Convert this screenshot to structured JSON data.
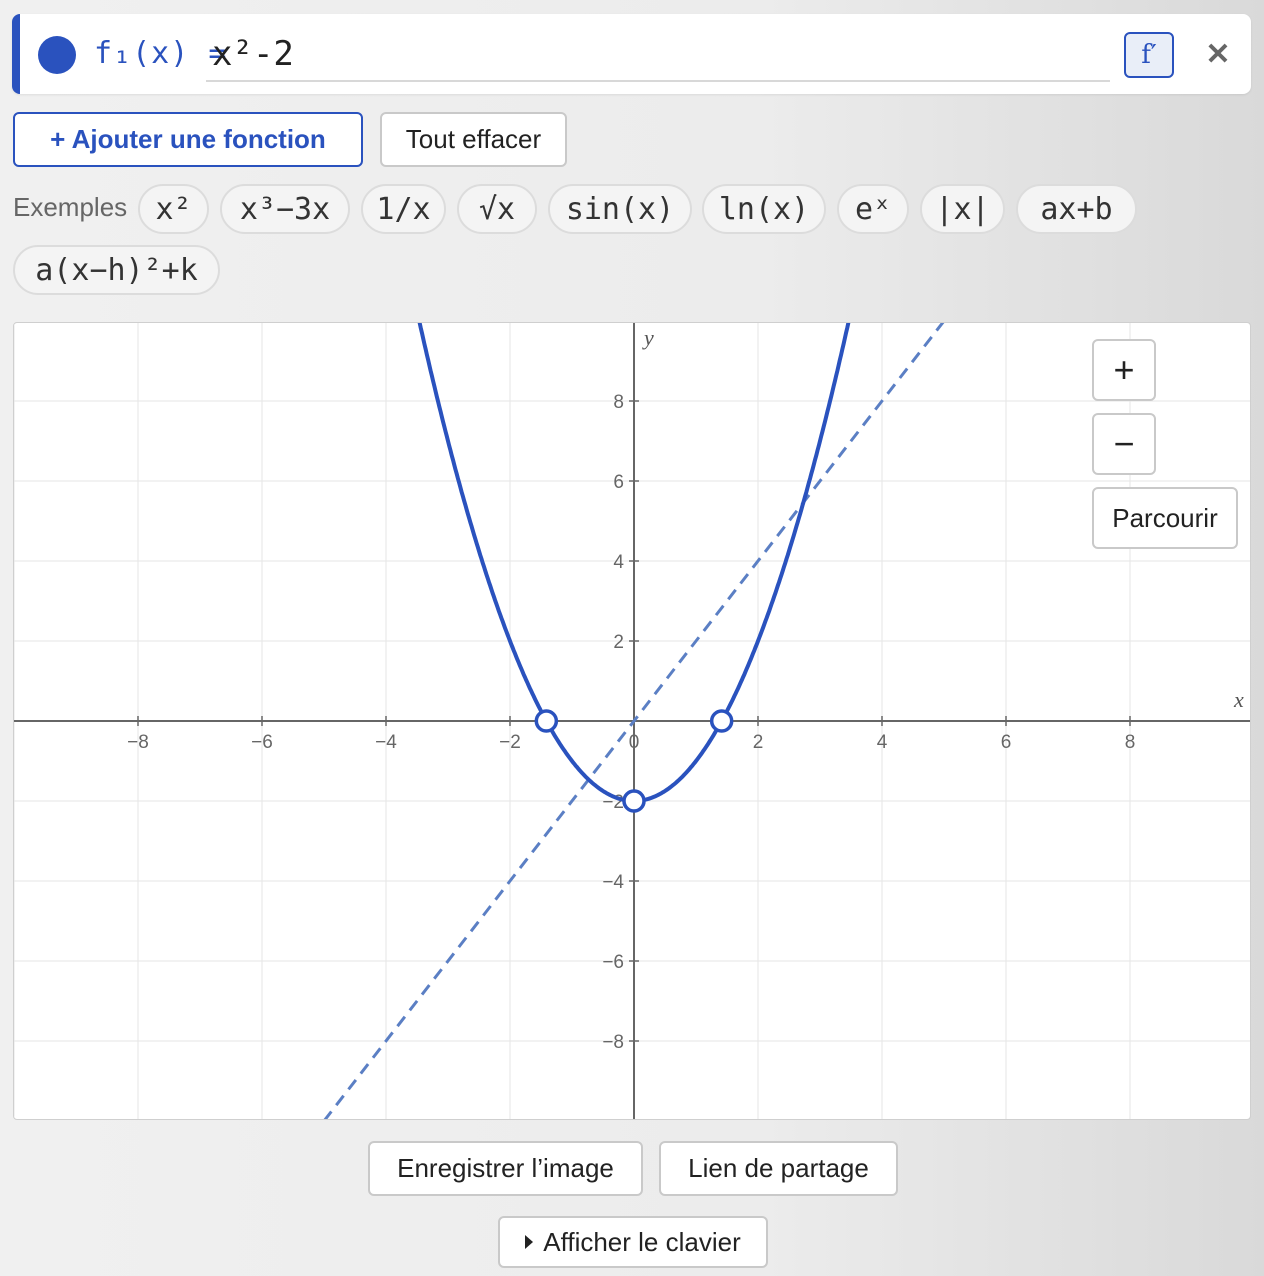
{
  "function": {
    "label": "f₁(x) =",
    "expression": "x²-2",
    "color": "#2a52be",
    "derivative_button": "f′",
    "close_label": "✕"
  },
  "actions": {
    "add_label": "+ Ajouter une fonction",
    "clear_label": "Tout effacer"
  },
  "examples": {
    "label": "Exemples",
    "items": [
      "x²",
      "x³−3x",
      "1/x",
      "√x",
      "sin(x)",
      "ln(x)",
      "eˣ",
      "|x|",
      "ax+b",
      "a(x−h)²+k"
    ]
  },
  "graph": {
    "x_axis_label": "x",
    "y_axis_label": "y",
    "zoom_in_label": "+",
    "zoom_out_label": "−",
    "trace_label": "Parcourir"
  },
  "chart_data": {
    "type": "line",
    "xlim": [
      -10,
      10
    ],
    "ylim": [
      -10,
      10
    ],
    "x_ticks": [
      -8,
      -6,
      -4,
      -2,
      0,
      2,
      4,
      6,
      8
    ],
    "y_ticks": [
      -8,
      -6,
      -4,
      -2,
      2,
      4,
      6,
      8
    ],
    "xlabel": "x",
    "ylabel": "y",
    "grid": true,
    "series": [
      {
        "expression": "x^2-2",
        "style": "solid",
        "color": "#2a52be"
      },
      {
        "expression": "2x",
        "style": "dashed",
        "color": "#5b7fc4"
      }
    ],
    "points": [
      {
        "x": -1.414,
        "y": 0
      },
      {
        "x": 1.414,
        "y": 0
      },
      {
        "x": 0,
        "y": -2
      }
    ]
  },
  "footer": {
    "save_label": "Enregistrer l’image",
    "share_label": "Lien de partage",
    "keyboard_label": "Afficher le clavier"
  }
}
